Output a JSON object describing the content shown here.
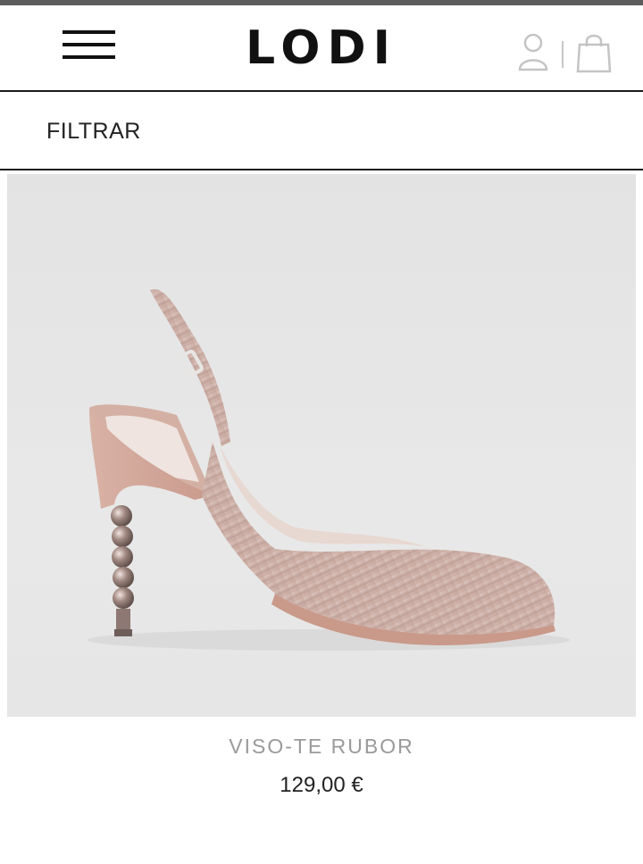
{
  "header": {
    "logo": "LODI",
    "menu_icon": "hamburger-menu-icon",
    "account_icon": "user-icon",
    "cart_icon": "shopping-bag-icon"
  },
  "filter": {
    "label": "FILTRAR"
  },
  "product": {
    "image_alt": "pink slingback pump with beaded metallic heel",
    "name": "VISO-TE RUBOR",
    "price": "129,00 €"
  },
  "colors": {
    "top_bar": "#5c5c5c",
    "text_dark": "#222222",
    "text_muted": "#9a9a9a",
    "image_background": "#e6e6e6"
  }
}
